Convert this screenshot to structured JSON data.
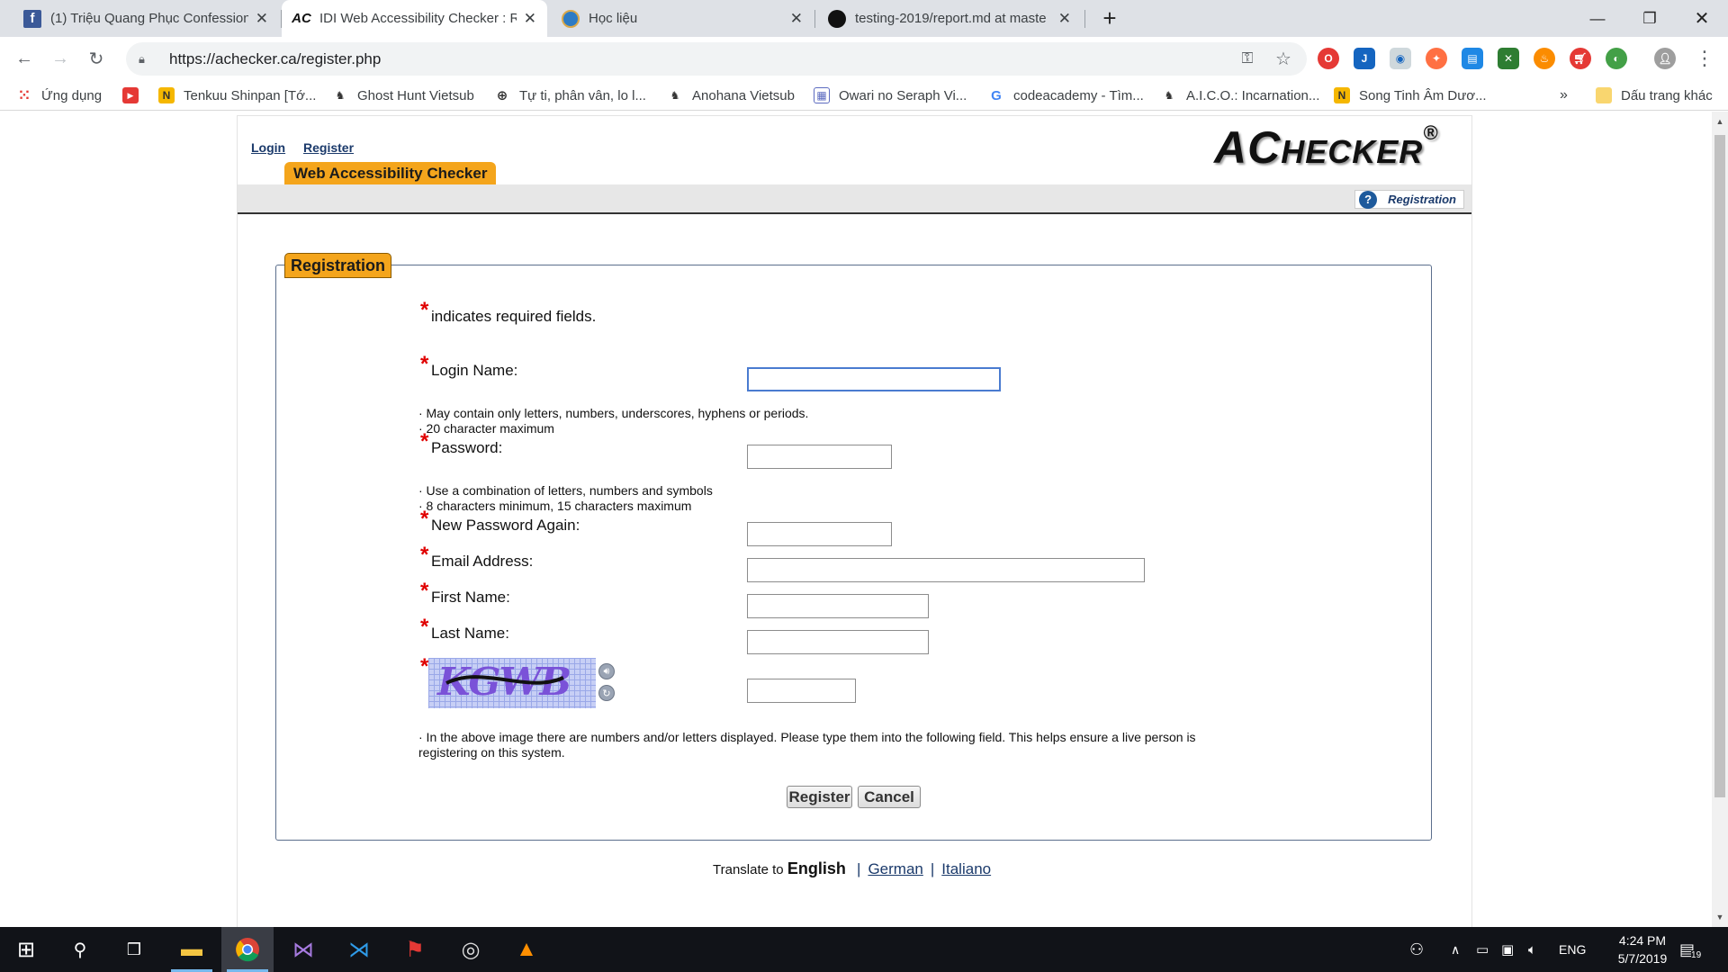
{
  "browser": {
    "tabs": [
      {
        "title": "(1) Triệu Quang Phục Confession",
        "favicon": "facebook-icon"
      },
      {
        "title": "IDI Web Accessibility Checker : R",
        "favicon": "achecker-icon",
        "favicon_text": "AC"
      },
      {
        "title": "Học liệu",
        "favicon": "globe-icon"
      },
      {
        "title": "testing-2019/report.md at maste",
        "favicon": "github-icon"
      }
    ],
    "url": "https://achecker.ca/register.php",
    "bookmarks": [
      {
        "label": "Ứng dụng",
        "icon": "apps-icon"
      },
      {
        "label": "",
        "icon": "youtube-icon"
      },
      {
        "label": "Tenkuu Shinpan [Tớ...",
        "icon": "n-icon"
      },
      {
        "label": "Ghost Hunt Vietsub",
        "icon": "bookmark-page-icon"
      },
      {
        "label": "Tự ti, phân vân, lo l...",
        "icon": "globe-icon"
      },
      {
        "label": "Anohana Vietsub",
        "icon": "bookmark-page-icon"
      },
      {
        "label": "Owari no Seraph Vi...",
        "icon": "bookmark-page-icon"
      },
      {
        "label": "codeacademy - Tìm...",
        "icon": "google-icon"
      },
      {
        "label": "A.I.C.O.: Incarnation...",
        "icon": "bookmark-page-icon"
      },
      {
        "label": "Song Tinh Âm Dươ...",
        "icon": "n-icon"
      }
    ],
    "bookmarks_overflow": "»",
    "other_bookmarks": "Dấu trang khác"
  },
  "page": {
    "top_links": {
      "login": "Login",
      "register": "Register"
    },
    "site_title": "Web Accessibility Checker",
    "logo": {
      "big_a": "AC",
      "rest": "HECKER",
      "reg": "®"
    },
    "breadcrumb": "Registration",
    "form": {
      "legend": "Registration",
      "required_note": "indicates required fields.",
      "required_mark": "*",
      "login_name": {
        "label": "Login Name:",
        "value": "",
        "hints": [
          "· May contain only letters, numbers, underscores, hyphens or periods.",
          "· 20 character maximum"
        ]
      },
      "password": {
        "label": "Password:",
        "value": "",
        "hints": [
          "· Use a combination of letters, numbers and symbols",
          "· 8 characters minimum, 15 characters maximum"
        ]
      },
      "password_again": {
        "label": "New Password Again:",
        "value": ""
      },
      "email": {
        "label": "Email Address:",
        "value": ""
      },
      "first_name": {
        "label": "First Name:",
        "value": ""
      },
      "last_name": {
        "label": "Last Name:",
        "value": ""
      },
      "captcha": {
        "image_text": "KGWB",
        "value": "",
        "hint_line1": "· In the above image there are numbers and/or letters displayed. Please type them into the following field. This helps ensure a live person is",
        "hint_line2": "registering on this system."
      },
      "register_button": "Register",
      "cancel_button": "Cancel"
    },
    "translate": {
      "prefix": "Translate to",
      "current": "English",
      "sep": "|",
      "options": [
        "German",
        "Italiano"
      ]
    }
  },
  "taskbar": {
    "lang": "ENG",
    "time": "4:24 PM",
    "date": "5/7/2019",
    "notifications": "19"
  },
  "colors": {
    "accent": "#f4a51c",
    "link": "#1b3a6b",
    "required": "#e00000",
    "taskbar": "#111318"
  }
}
